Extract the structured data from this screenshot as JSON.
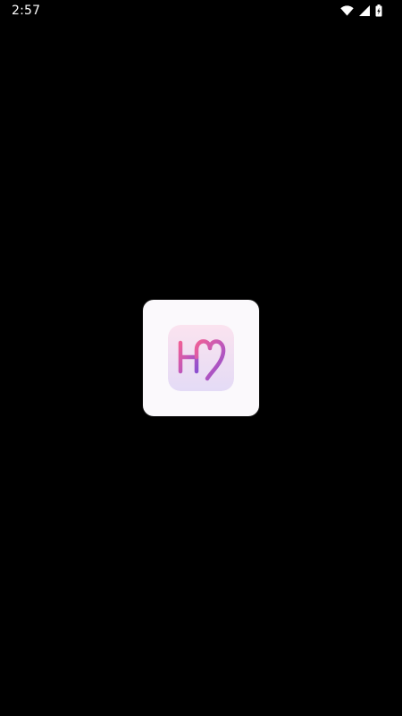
{
  "status_bar": {
    "time": "2:57",
    "icons": [
      "wifi-icon",
      "cellular-signal-icon",
      "battery-charging-icon"
    ]
  },
  "splash": {
    "icon": "app-logo-icon",
    "logo_text": "H♡",
    "colors": {
      "background": "#000000",
      "card": "#fbf9fc",
      "icon_gradient_top": "#fbe3ef",
      "icon_gradient_bottom": "#e4dbf6",
      "logo_pink": "#e65a9c",
      "logo_purple": "#8c4fd0"
    }
  }
}
